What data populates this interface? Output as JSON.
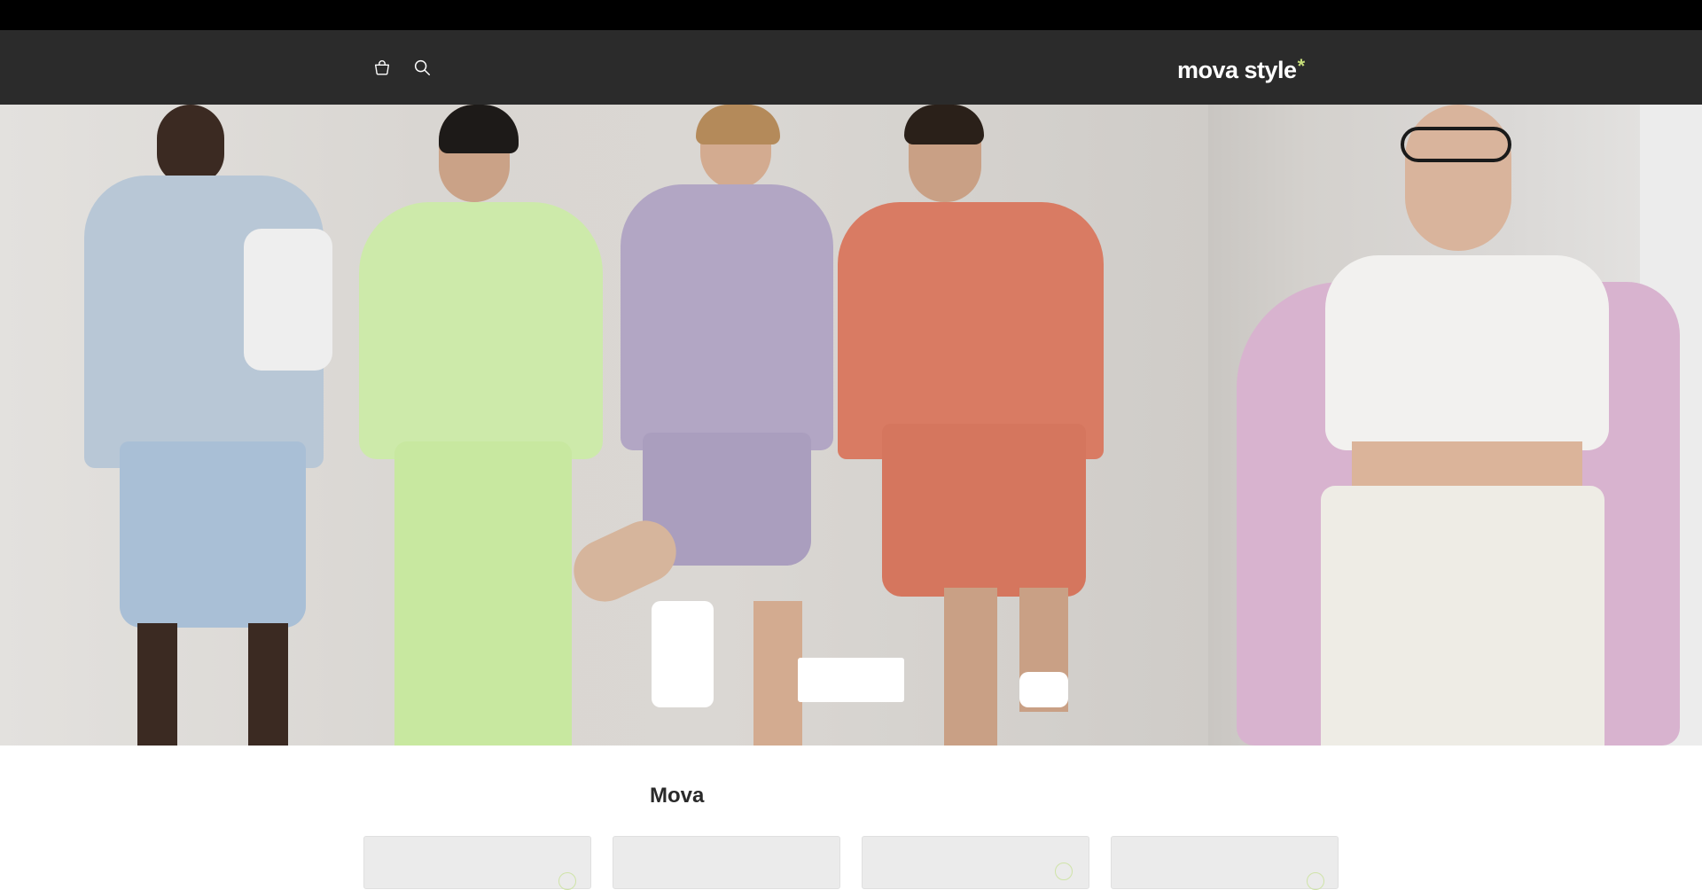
{
  "header": {
    "logo_text": "mova style",
    "logo_star": "*",
    "logo_star_color": "#c7df7a",
    "background": "#2b2b2b",
    "icons": [
      "shopping-basket-icon",
      "search-icon"
    ]
  },
  "hero": {
    "cta_label": "",
    "accent_colors": {
      "hoodie_blue": "#b8c7d6",
      "hoodie_green": "#cdeaaa",
      "sweat_lilac": "#b2a6c4",
      "tee_coral": "#d97b63",
      "jacket_pink": "#d8b3cf"
    }
  },
  "collection": {
    "title": "Mova",
    "cards": [
      {
        "badge": true
      },
      {
        "badge": false
      },
      {
        "badge": true
      },
      {
        "badge": true
      }
    ]
  }
}
